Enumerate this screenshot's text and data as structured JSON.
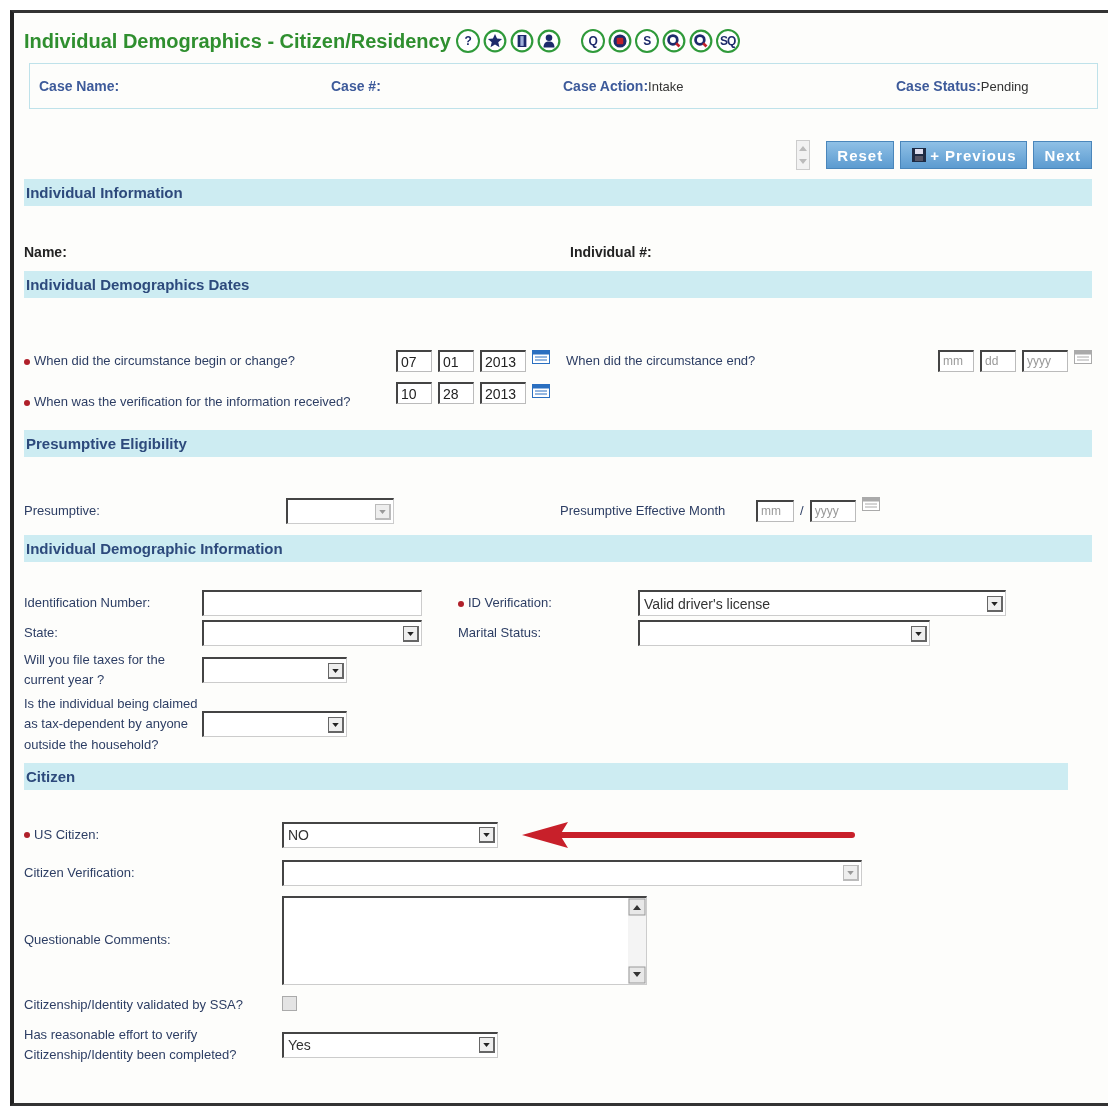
{
  "title": "Individual Demographics - Citizen/Residency",
  "title_icon_groups": [
    [
      {
        "kind": "text",
        "glyph": "?"
      },
      {
        "kind": "star"
      },
      {
        "kind": "book"
      },
      {
        "kind": "person"
      }
    ],
    [
      {
        "kind": "text",
        "glyph": "Q"
      },
      {
        "kind": "stop"
      },
      {
        "kind": "text",
        "glyph": "S"
      },
      {
        "kind": "search"
      },
      {
        "kind": "search"
      },
      {
        "kind": "text",
        "glyph": "SQ"
      }
    ]
  ],
  "case_bar": [
    {
      "label": "Case Name:"
    },
    {
      "label": "Case #:"
    },
    {
      "label": "Case Action:",
      "value": "Intake"
    },
    {
      "label": "Case Status:",
      "value": "Pending"
    }
  ],
  "buttons": [
    {
      "label": "Reset",
      "kind": "plain"
    },
    {
      "label": "+ Previous",
      "kind": "save"
    },
    {
      "label": "Next",
      "kind": "plain"
    }
  ],
  "individual_information": {
    "heading": "Individual Information",
    "name_label": "Name:",
    "number_label": "Individual #:"
  },
  "dates": {
    "heading": "Individual Demographics Dates",
    "begin": {
      "label": "When did the circumstance begin or change?",
      "required": true,
      "mm": "07",
      "dd": "01",
      "yyyy": "2013"
    },
    "end": {
      "label": "When did the circumstance end?",
      "required": false,
      "mm_placeholder": "mm",
      "dd_placeholder": "dd",
      "yyyy_placeholder": "yyyy"
    },
    "verification": {
      "label": "When was the verification for the information received?",
      "required": true,
      "mm": "10",
      "dd": "28",
      "yyyy": "2013"
    }
  },
  "presumptive": {
    "heading": "Presumptive Eligibility",
    "label": "Presumptive:",
    "month_label": "Presumptive Effective Month",
    "mm_placeholder": "mm",
    "separator": "/",
    "yyyy_placeholder": "yyyy"
  },
  "demographic": {
    "heading": "Individual Demographic Information",
    "id_number_label": "Identification Number:",
    "id_verification": {
      "label": "ID Verification:",
      "required": true,
      "value": "Valid driver's license"
    },
    "state_label": "State:",
    "marital_label": "Marital Status:",
    "taxes_label": "Will you file taxes for the current year ?",
    "dependent_label": "Is the individual being claimed as tax-dependent by anyone outside the household?"
  },
  "citizen": {
    "heading": "Citizen",
    "us_citizen": {
      "label": "US Citizen:",
      "required": true,
      "value": "NO"
    },
    "verification_label": "Citizen Verification:",
    "comments_label": "Questionable Comments:",
    "ssa": {
      "label": "Citizenship/Identity validated by SSA?",
      "checked": false,
      "disabled": true
    },
    "reasonable": {
      "label": "Has reasonable effort to verify Citizenship/Identity been completed?",
      "value": "Yes"
    }
  }
}
